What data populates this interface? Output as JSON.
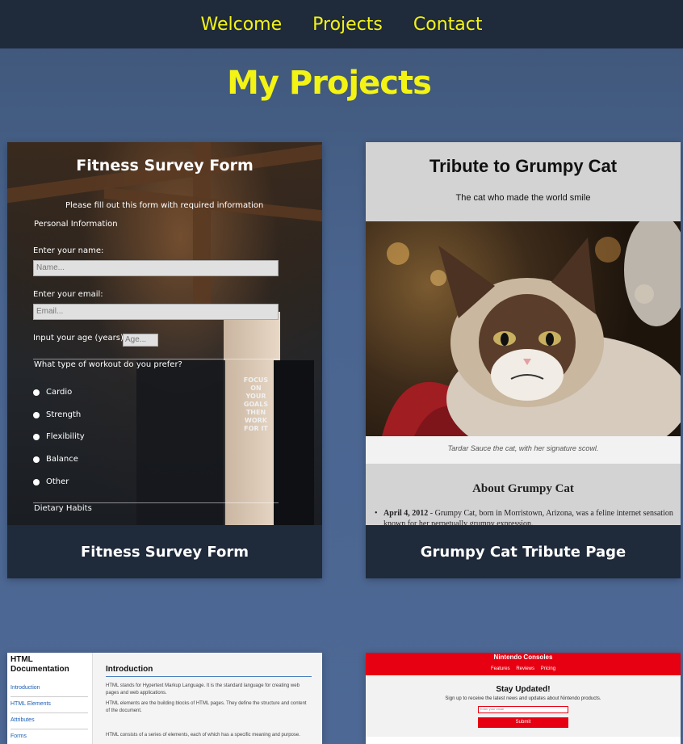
{
  "nav": {
    "welcome": "Welcome",
    "projects": "Projects",
    "contact": "Contact"
  },
  "page_title": "My Projects",
  "colors": {
    "accent_yellow": "#f3f314",
    "nav_bg": "#1f2a3b",
    "page_bg": "#4a6590"
  },
  "projects": [
    {
      "caption": "Fitness Survey Form",
      "preview": {
        "title": "Fitness Survey Form",
        "subtitle": "Please fill out this form with required information",
        "section1": "Personal Information",
        "name_label": "Enter your name:",
        "name_placeholder": "Name...",
        "email_label": "Enter your email:",
        "email_placeholder": "Email...",
        "age_label": "Input your age (years):",
        "age_placeholder": "Age...",
        "workout_question": "What type of workout do you prefer?",
        "workout_options": [
          "Cardio",
          "Strength",
          "Flexibility",
          "Balance",
          "Other"
        ],
        "section2": "Dietary Habits",
        "poster_text": "FOCUS ON YOUR GOALS THEN WORK FOR IT"
      }
    },
    {
      "caption": "Grumpy Cat Tribute Page",
      "preview": {
        "title": "Tribute to Grumpy Cat",
        "subtitle": "The cat who made the world smile",
        "image_caption": "Tardar Sauce the cat, with her signature scowl.",
        "about_heading": "About Grumpy Cat",
        "timeline_date": "April 4, 2012",
        "timeline_text": " - Grumpy Cat, born in Morristown, Arizona, was a feline internet sensation known for her perpetually grumpy expression."
      }
    },
    {
      "preview": {
        "sidebar_title": "HTML Documentation",
        "links": [
          "Introduction",
          "HTML Elements",
          "Attributes",
          "Forms"
        ],
        "heading": "Introduction",
        "paragraphs": [
          "HTML stands for Hypertext Markup Language. It is the standard language for creating web pages and web applications.",
          "HTML elements are the building blocks of HTML pages. They define the structure and content of the document.",
          "HTML consists of a series of elements, each of which has a specific meaning and purpose."
        ]
      }
    },
    {
      "preview": {
        "brand": "Nintendo Consoles",
        "nav": [
          "Features",
          "Reviews",
          "Pricing"
        ],
        "heading": "Stay Updated!",
        "text": "Sign up to receive the latest news and updates about Nintendo products.",
        "email_placeholder": "Enter your email",
        "submit_label": "Submit"
      }
    }
  ]
}
